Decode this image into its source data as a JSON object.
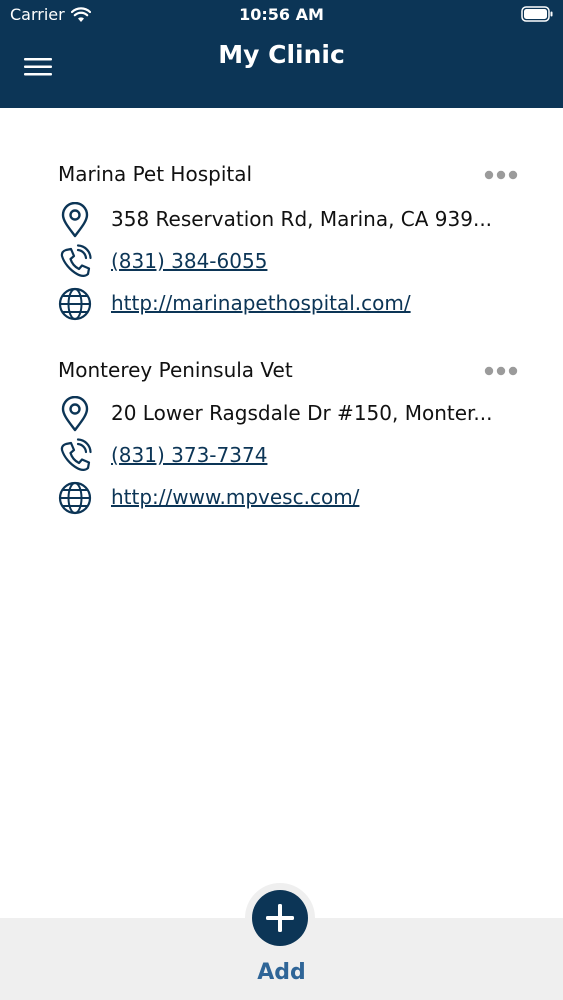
{
  "status_bar": {
    "carrier": "Carrier",
    "time": "10:56 AM"
  },
  "header": {
    "title": "My Clinic",
    "menu_icon": "hamburger-menu-icon"
  },
  "clinics": [
    {
      "name": "Marina Pet Hospital",
      "address": "358 Reservation Rd, Marina, CA 939...",
      "phone": "(831) 384-6055",
      "website": "http://marinapethospital.com/"
    },
    {
      "name": "Monterey Peninsula Vet",
      "address": "20 Lower Ragsdale Dr #150, Monter...",
      "phone": "(831) 373-7374",
      "website": "http://www.mpvesc.com/"
    }
  ],
  "footer": {
    "add_label": "Add",
    "add_icon": "plus-icon"
  },
  "colors": {
    "brand_navy": "#0c3556",
    "add_label_blue": "#2f6597",
    "footer_bg": "#efefef",
    "more_dots": "#9b9b9b"
  }
}
